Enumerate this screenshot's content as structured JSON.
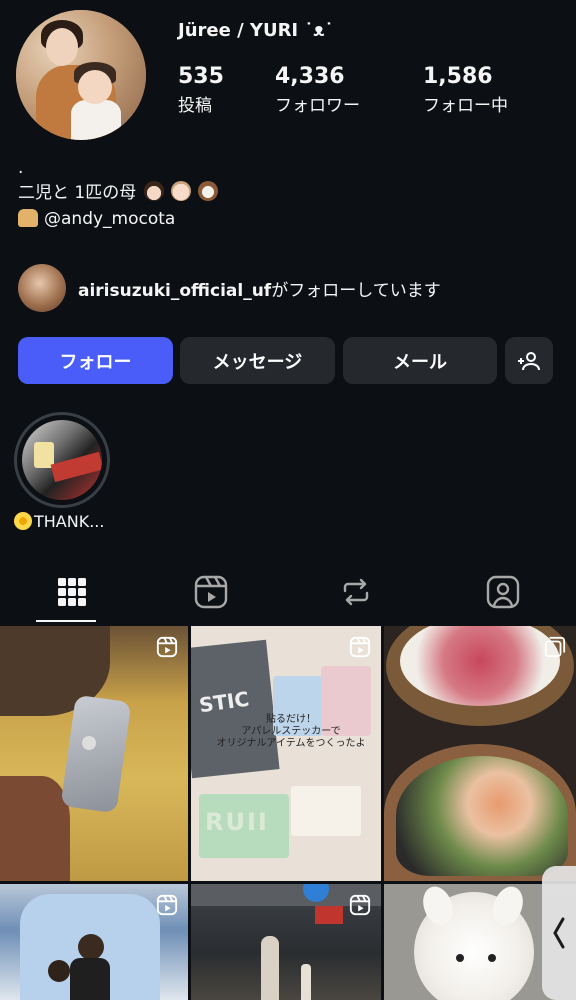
{
  "profile": {
    "name": "Jüree / YURI ˙ᴥ˙",
    "stats": [
      {
        "value": "535",
        "label": "投稿"
      },
      {
        "value": "4,336",
        "label": "フォロワー"
      },
      {
        "value": "1,586",
        "label": "フォロー中"
      }
    ]
  },
  "bio": {
    "dot": ".",
    "line1": "二児と 1匹の母",
    "line2": "@andy_mocota"
  },
  "mutual": {
    "username": "airisuzuki_official_uf",
    "suffix": "がフォローしています"
  },
  "actions": {
    "follow": "フォロー",
    "message": "メッセージ",
    "email": "メール"
  },
  "highlight": {
    "label": "THANK..."
  },
  "grid": {
    "post2_caption_line1": "貼るだけ！",
    "post2_caption_line2": "アパレルステッカーで",
    "post2_caption_line3": "オリジナルアイテムをつくったよ",
    "post2_sign": "STIC",
    "post2_letters": "RUII"
  },
  "colors": {
    "background": "#0c1014",
    "follow_button": "#4a5df9",
    "secondary_button": "#25292e"
  }
}
